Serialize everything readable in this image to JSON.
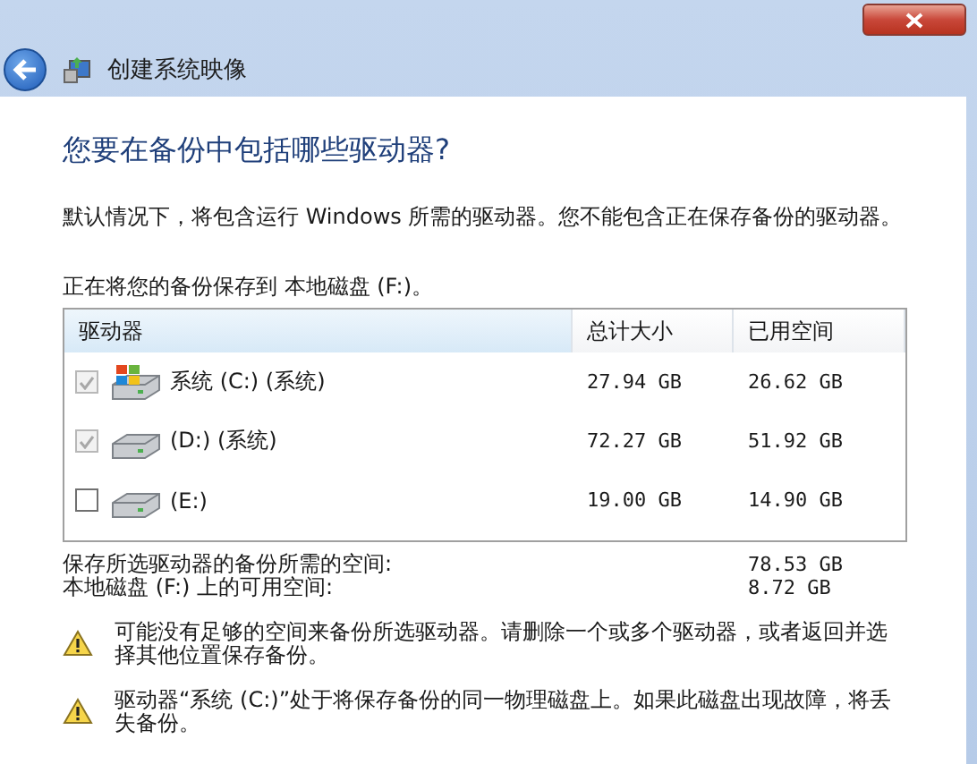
{
  "window": {
    "title": "创建系统映像"
  },
  "heading": "您要在备份中包括哪些驱动器?",
  "description": "默认情况下，将包含运行 Windows 所需的驱动器。您不能包含正在保存备份的驱动器。",
  "destination": "正在将您的备份保存到 本地磁盘 (F:)。",
  "table": {
    "columns": [
      "驱动器",
      "总计大小",
      "已用空间"
    ],
    "rows": [
      {
        "kind": "system",
        "name": "系统 (C:) (系统)",
        "total": "27.94 GB",
        "used": "26.62 GB",
        "checked": true,
        "disabled": true
      },
      {
        "kind": "disk",
        "name": "(D:) (系统)",
        "total": "72.27 GB",
        "used": "51.92 GB",
        "checked": true,
        "disabled": true
      },
      {
        "kind": "disk",
        "name": "(E:)",
        "total": "19.00 GB",
        "used": "14.90 GB",
        "checked": false,
        "disabled": false
      }
    ]
  },
  "summary": [
    {
      "label": "保存所选驱动器的备份所需的空间:",
      "value": "78.53 GB"
    },
    {
      "label": "本地磁盘 (F:) 上的可用空间:",
      "value": "8.72 GB"
    }
  ],
  "warnings": [
    "可能没有足够的空间来备份所选驱动器。请删除一个或多个驱动器，或者返回并选择其他位置保存备份。",
    "驱动器“系统 (C:)”处于将保存备份的同一物理磁盘上。如果此磁盘出现故障，将丢失备份。"
  ]
}
